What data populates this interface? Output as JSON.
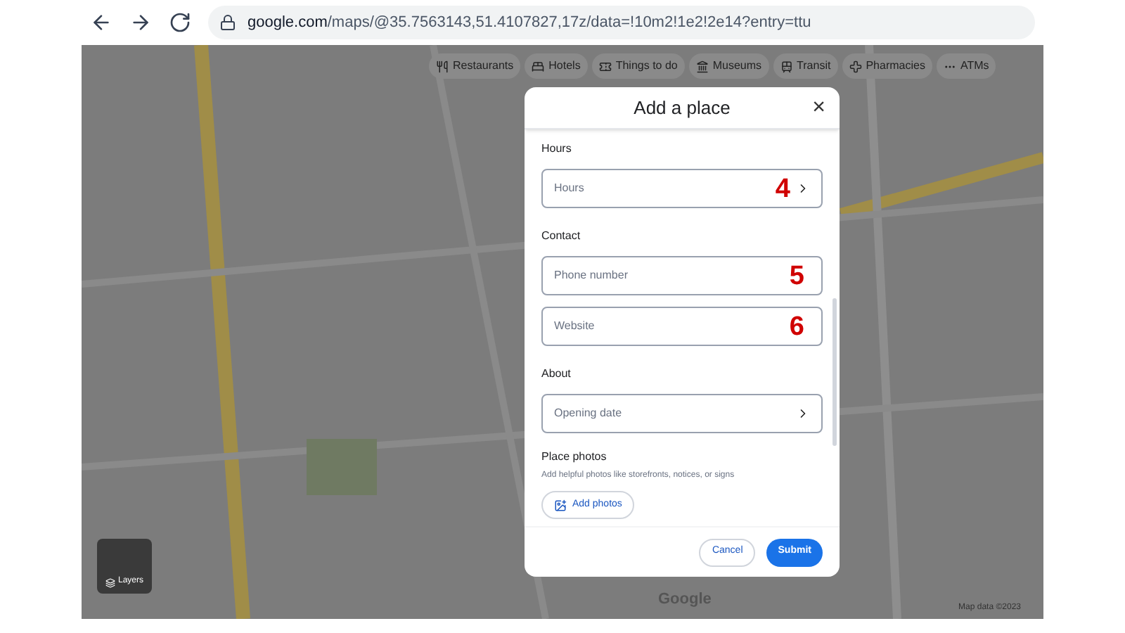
{
  "browser": {
    "url_host": "google.com",
    "url_path": "/maps/@35.7563143,51.4107827,17z/data=!10m2!1e2!2e14?entry=ttu"
  },
  "map": {
    "chips": [
      {
        "label": "Restaurants"
      },
      {
        "label": "Hotels"
      },
      {
        "label": "Things to do"
      },
      {
        "label": "Museums"
      },
      {
        "label": "Transit"
      },
      {
        "label": "Pharmacies"
      },
      {
        "label": "ATMs"
      }
    ],
    "layers_label": "Layers",
    "logo": "Google",
    "attribution": "Map data ©2023"
  },
  "dialog": {
    "title": "Add a place",
    "close": "×",
    "sections": [
      {
        "heading": "Hours",
        "fields": [
          {
            "kind": "select",
            "placeholder": "Hours",
            "annotation": "4"
          }
        ]
      },
      {
        "heading": "Contact",
        "fields": [
          {
            "kind": "input",
            "placeholder": "Phone number",
            "annotation": "5"
          },
          {
            "kind": "input",
            "placeholder": "Website",
            "annotation": "6"
          }
        ]
      },
      {
        "heading": "About",
        "fields": [
          {
            "kind": "select",
            "placeholder": "Opening date"
          }
        ]
      }
    ],
    "photos": {
      "heading": "Place photos",
      "note": "Add helpful photos like storefronts, notices, or signs",
      "button": "Add photos"
    },
    "buttons": [
      {
        "kind": "secondary",
        "label": "Cancel"
      },
      {
        "kind": "primary",
        "label": "Submit"
      }
    ]
  }
}
